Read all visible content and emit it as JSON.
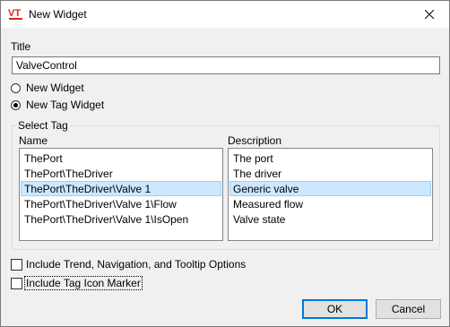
{
  "window": {
    "title": "New Widget",
    "app_icon": "vt-scada-logo-icon",
    "close_icon": "close-icon"
  },
  "title_field": {
    "label": "Title",
    "value": "ValveControl"
  },
  "widget_type": {
    "options": [
      {
        "label": "New Widget",
        "checked": false
      },
      {
        "label": "New Tag Widget",
        "checked": true
      }
    ]
  },
  "select_tag": {
    "group_label": "Select Tag",
    "name_header": "Name",
    "description_header": "Description",
    "rows": [
      {
        "name": "ThePort",
        "description": "The port",
        "selected": false
      },
      {
        "name": "ThePort\\TheDriver",
        "description": "The driver",
        "selected": false
      },
      {
        "name": "ThePort\\TheDriver\\Valve 1",
        "description": "Generic valve",
        "selected": true
      },
      {
        "name": "ThePort\\TheDriver\\Valve 1\\Flow",
        "description": "Measured flow",
        "selected": false
      },
      {
        "name": "ThePort\\TheDriver\\Valve 1\\IsOpen",
        "description": "Valve state",
        "selected": false
      }
    ]
  },
  "options": {
    "include_trend": {
      "label": "Include Trend, Navigation, and Tooltip Options",
      "checked": false
    },
    "include_icon_marker": {
      "label": "Include Tag Icon Marker",
      "checked": false
    }
  },
  "buttons": {
    "ok": "OK",
    "cancel": "Cancel"
  },
  "colors": {
    "selection_bg": "#cce8ff",
    "selection_border": "#99d1ff",
    "logo_red": "#d9232a"
  }
}
